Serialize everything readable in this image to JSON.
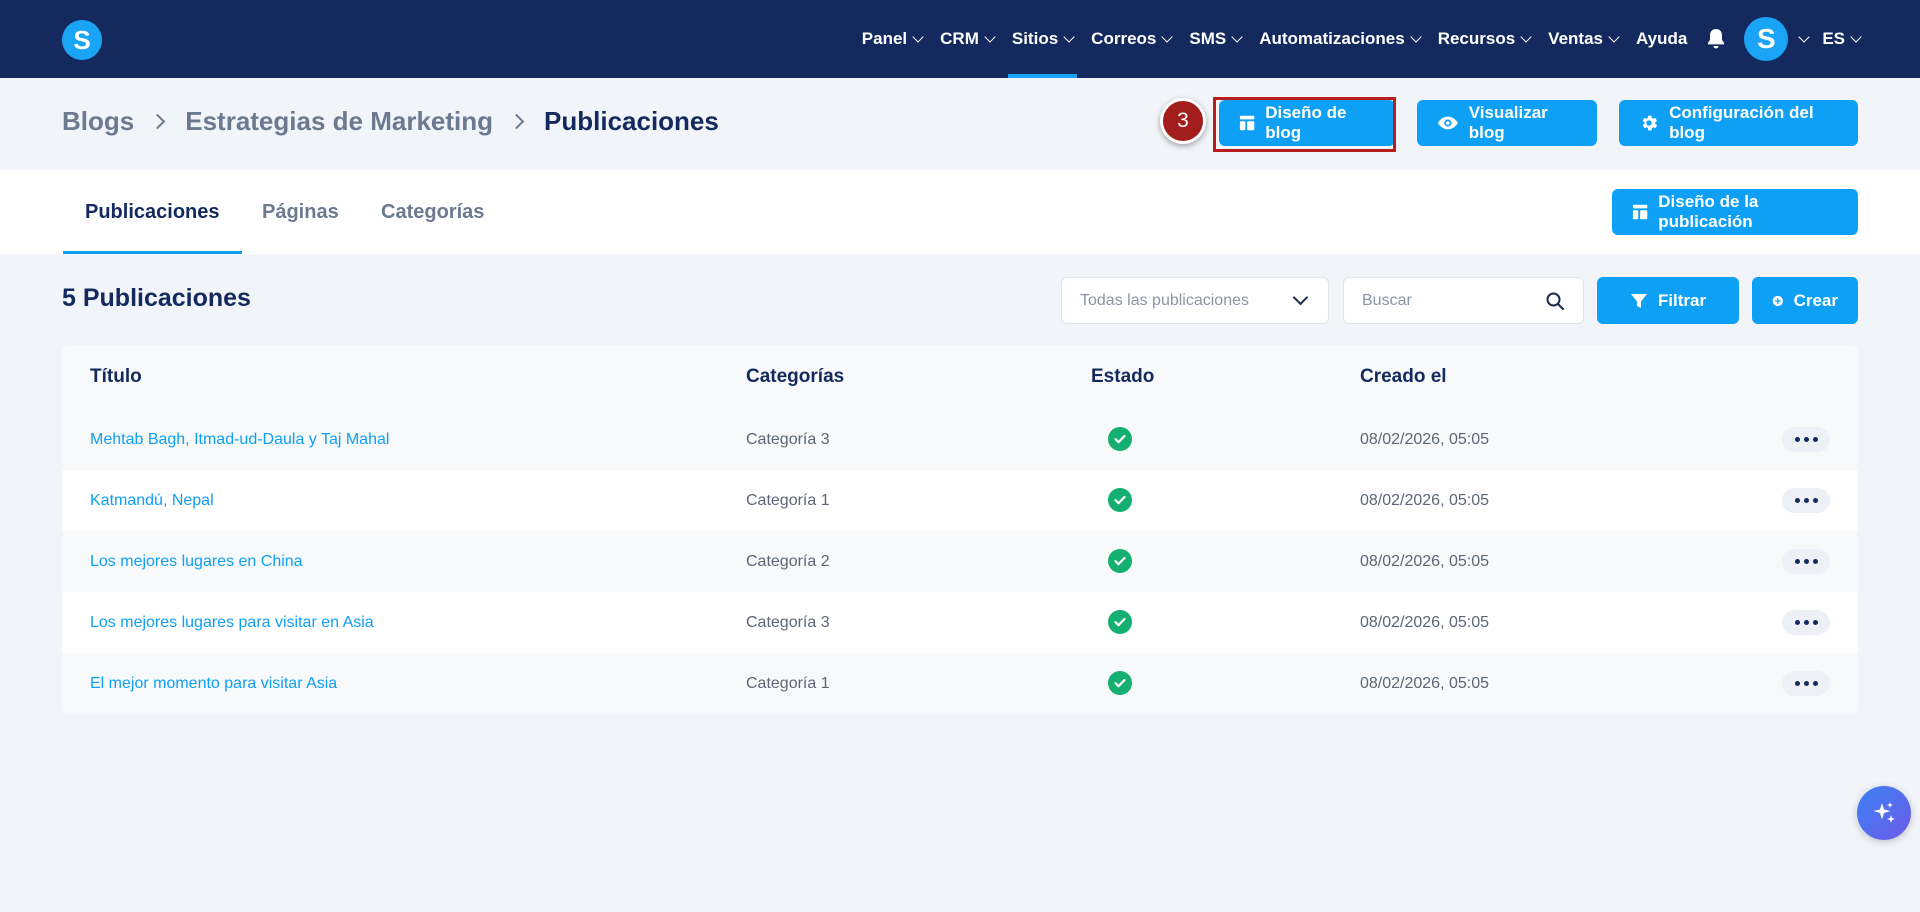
{
  "brand": {
    "logo_letter": "S",
    "accent": "#0ea0f5",
    "navbar_bg": "#142a5e"
  },
  "nav": {
    "items": [
      {
        "label": "Panel",
        "has_dropdown": true
      },
      {
        "label": "CRM",
        "has_dropdown": true
      },
      {
        "label": "Sitios",
        "has_dropdown": true,
        "active": true
      },
      {
        "label": "Correos",
        "has_dropdown": true
      },
      {
        "label": "SMS",
        "has_dropdown": true
      },
      {
        "label": "Automatizaciones",
        "has_dropdown": true
      },
      {
        "label": "Recursos",
        "has_dropdown": true
      },
      {
        "label": "Ventas",
        "has_dropdown": true
      },
      {
        "label": "Ayuda",
        "has_dropdown": false
      }
    ],
    "bell_icon": "bell-icon",
    "avatar_letter": "S",
    "language": "ES"
  },
  "breadcrumb": {
    "items": [
      "Blogs",
      "Estrategias de Marketing"
    ],
    "current": "Publicaciones"
  },
  "header_actions": {
    "design": "Diseño de blog",
    "view": "Visualizar blog",
    "settings": "Configuración del blog"
  },
  "annotation": {
    "step": "3",
    "color": "#a31d1d"
  },
  "tabs": {
    "items": [
      "Publicaciones",
      "Páginas",
      "Categorías"
    ],
    "active": "Publicaciones",
    "post_design_button": "Diseño de la publicación"
  },
  "toolbar": {
    "count_title": "5 Publicaciones",
    "select_value": "Todas las publicaciones",
    "search_placeholder": "Buscar",
    "filter_label": "Filtrar",
    "create_label": "Crear"
  },
  "table": {
    "columns": [
      "Título",
      "Categorías",
      "Estado",
      "Creado el"
    ],
    "rows": [
      {
        "title": "Mehtab Bagh, Itmad-ud-Daula y Taj Mahal",
        "category": "Categoría 3",
        "status": "published",
        "created": "08/02/2026, 05:05"
      },
      {
        "title": "Katmandú, Nepal",
        "category": "Categoría 1",
        "status": "published",
        "created": "08/02/2026, 05:05"
      },
      {
        "title": "Los mejores lugares en China",
        "category": "Categoría 2",
        "status": "published",
        "created": "08/02/2026, 05:05"
      },
      {
        "title": "Los mejores lugares para visitar en Asia",
        "category": "Categoría 3",
        "status": "published",
        "created": "08/02/2026, 05:05"
      },
      {
        "title": "El mejor momento para visitar Asia",
        "category": "Categoría 1",
        "status": "published",
        "created": "08/02/2026, 05:05"
      }
    ]
  },
  "fab_icon": "sparkles-icon"
}
